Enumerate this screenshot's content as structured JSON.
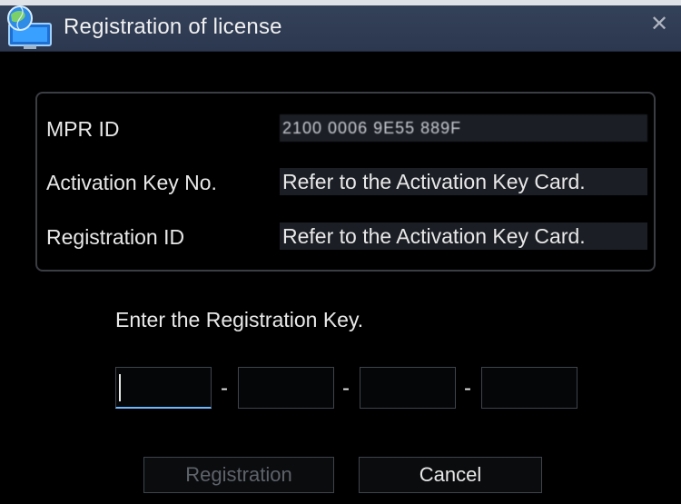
{
  "window": {
    "title": "Registration of license",
    "close_glyph": "✕"
  },
  "info": [
    {
      "label": "MPR ID",
      "value": "2100 0006 9E55 889F"
    },
    {
      "label": "Activation Key No.",
      "value": "Refer to the Activation Key Card."
    },
    {
      "label": "Registration ID",
      "value": "Refer to the Activation Key Card."
    }
  ],
  "key_entry": {
    "prompt": "Enter the Registration Key.",
    "separator": "-",
    "fields": [
      "",
      "",
      "",
      ""
    ]
  },
  "buttons": {
    "registration_label": "Registration",
    "registration_enabled": false,
    "cancel_label": "Cancel"
  },
  "colors": {
    "background": "#000000",
    "title_bar": "#2f3b52",
    "focus_accent": "#6fb8ff",
    "disabled_text": "#5e636b"
  },
  "icons": {
    "app_icon": "globe-computer-icon",
    "close": "close-icon"
  }
}
